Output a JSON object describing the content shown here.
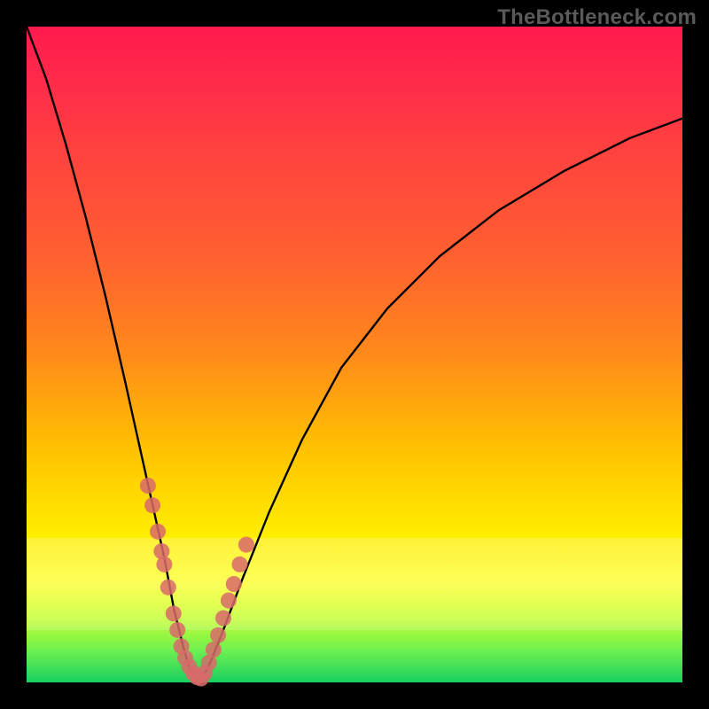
{
  "watermark": "TheBottleneck.com",
  "chart_data": {
    "type": "line",
    "title": "",
    "xlabel": "",
    "ylabel": "",
    "xlim": [
      0,
      100
    ],
    "ylim": [
      0,
      100
    ],
    "series": [
      {
        "name": "bottleneck-curve",
        "x": [
          0,
          3,
          6,
          9,
          12,
          15,
          17,
          19,
          21,
          22.5,
          24,
          25,
          26,
          27,
          28,
          30,
          33,
          37,
          42,
          48,
          55,
          63,
          72,
          82,
          92,
          100
        ],
        "y": [
          100,
          92,
          82,
          71,
          59,
          46,
          37,
          28,
          19,
          11,
          5,
          1.5,
          0.5,
          1,
          3,
          8,
          16,
          26,
          37,
          48,
          57,
          65,
          72,
          78,
          83,
          86
        ]
      }
    ],
    "markers": [
      {
        "name": "left-branch-dots",
        "x": [
          18.5,
          19.2,
          20.0,
          20.6,
          21.0,
          21.6,
          22.4,
          23.0,
          23.6,
          24.2,
          24.8,
          25.4,
          26.0,
          26.6
        ],
        "y": [
          30.0,
          27.0,
          23.0,
          20.0,
          18.0,
          14.5,
          10.5,
          8.0,
          5.5,
          3.7,
          2.4,
          1.4,
          0.8,
          0.6
        ]
      },
      {
        "name": "right-branch-dots",
        "x": [
          27.2,
          27.8,
          28.5,
          29.2,
          30.0,
          30.8,
          31.6,
          32.5,
          33.5
        ],
        "y": [
          1.5,
          3.0,
          5.0,
          7.2,
          9.8,
          12.5,
          15.0,
          18.0,
          21.0
        ]
      }
    ],
    "colors": {
      "curve": "#000000",
      "marker": "#d86a6a"
    }
  }
}
